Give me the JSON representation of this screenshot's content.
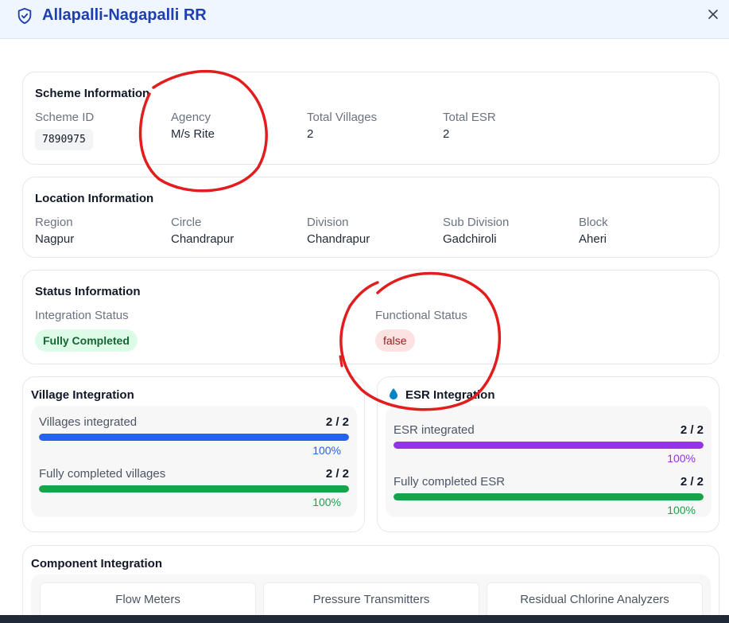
{
  "header": {
    "title": "Allapalli-Nagapalli RR"
  },
  "scheme": {
    "title": "Scheme Information",
    "fields": [
      {
        "label": "Scheme ID",
        "value": "7890975"
      },
      {
        "label": "Agency",
        "value": "M/s Rite"
      },
      {
        "label": "Total Villages",
        "value": "2"
      },
      {
        "label": "Total ESR",
        "value": "2"
      }
    ]
  },
  "location": {
    "title": "Location Information",
    "fields": [
      {
        "label": "Region",
        "value": "Nagpur"
      },
      {
        "label": "Circle",
        "value": "Chandrapur"
      },
      {
        "label": "Division",
        "value": "Chandrapur"
      },
      {
        "label": "Sub Division",
        "value": "Gadchiroli"
      },
      {
        "label": "Block",
        "value": "Aheri"
      }
    ]
  },
  "status": {
    "title": "Status Information",
    "integration_label": "Integration Status",
    "integration_value": "Fully Completed",
    "functional_label": "Functional Status",
    "functional_value": "false"
  },
  "village": {
    "title": "Village Integration",
    "metrics": [
      {
        "label": "Villages integrated",
        "count": "2 / 2",
        "percent": "100%",
        "fraction": 1.0,
        "color": "#2563eb"
      },
      {
        "label": "Fully completed villages",
        "count": "2 / 2",
        "percent": "100%",
        "fraction": 1.0,
        "color": "#16a34a"
      }
    ]
  },
  "esr": {
    "title": "ESR Integration",
    "icon": "water-drop-icon",
    "metrics": [
      {
        "label": "ESR integrated",
        "count": "2 / 2",
        "percent": "100%",
        "fraction": 1.0,
        "color": "#9333ea"
      },
      {
        "label": "Fully completed ESR",
        "count": "2 / 2",
        "percent": "100%",
        "fraction": 1.0,
        "color": "#16a34a"
      }
    ]
  },
  "component": {
    "title": "Component Integration",
    "items": [
      "Flow Meters",
      "Pressure Transmitters",
      "Residual Chlorine Analyzers"
    ]
  },
  "colors": {
    "accent": "#1e40af",
    "annotation": "#e11d1d"
  }
}
